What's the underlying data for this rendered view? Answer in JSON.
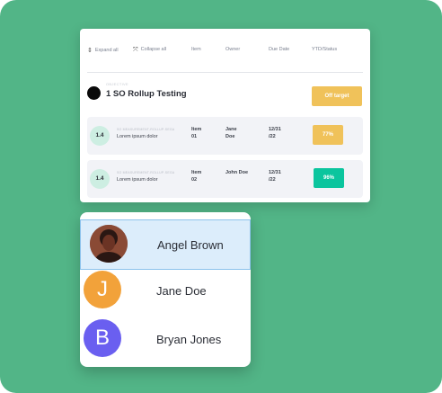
{
  "table": {
    "headers": {
      "expand_all": "Expand all",
      "collapse_all": "Collapse all",
      "item": "Item",
      "owner": "Owner",
      "due_date": "Due Date",
      "ytd_status": "YTD/Status"
    },
    "root": {
      "sublabel": "OBJECTIVE",
      "title": "1 SO Rollup Testing",
      "status": "Off target"
    },
    "rows": [
      {
        "badge": "1.4",
        "sublabel": "SO MEASUREMENT-ROLLUP-SEGA",
        "desc": "Lorem ipsum dolor",
        "item_line1": "Item",
        "item_line2": "01",
        "owner_line1": "Jane",
        "owner_line2": "Doe",
        "due_line1": "12/31",
        "due_line2": "/22",
        "status": "77%"
      },
      {
        "badge": "1.4",
        "sublabel": "SO MEASUREMENT-ROLLUP-SEGA",
        "desc": "Lorem ipsum dolor",
        "item_line1": "Item",
        "item_line2": "02",
        "owner_line1": "John Doe",
        "owner_line2": "",
        "due_line1": "12/31",
        "due_line2": "/22",
        "status": "96%"
      }
    ]
  },
  "people": [
    {
      "name": "Angel Brown",
      "initial": "",
      "selected": true
    },
    {
      "name": "Jane Doe",
      "initial": "J",
      "color": "#f2a23a",
      "selected": false
    },
    {
      "name": "Bryan Jones",
      "initial": "B",
      "color": "#6a5ff0",
      "selected": false
    }
  ],
  "colors": {
    "background": "#52b587",
    "status_off_target": "#f0c25a",
    "status_77": "#f0c25a",
    "status_96": "#0bc59e",
    "selection": "#dcedfb"
  }
}
